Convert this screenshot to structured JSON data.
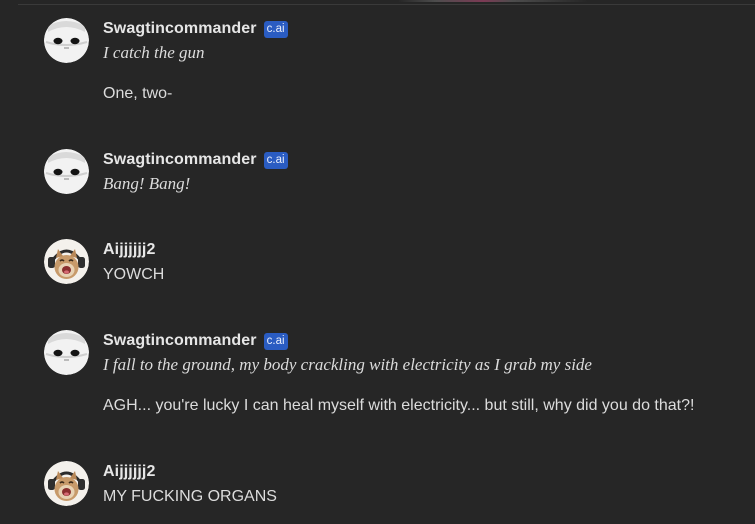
{
  "messages": [
    {
      "author": "Swagtincommander",
      "badge": "c.ai",
      "avatar": "robot-avatar-icon",
      "lines": [
        {
          "text": "I catch the gun",
          "italic": true
        },
        {
          "text": "One, two-",
          "italic": false
        }
      ]
    },
    {
      "author": "Swagtincommander",
      "badge": "c.ai",
      "avatar": "robot-avatar-icon",
      "lines": [
        {
          "text": "Bang! Bang!",
          "italic": true
        }
      ]
    },
    {
      "author": "Aijjjjjj2",
      "badge": null,
      "avatar": "cat-headphones-avatar-icon",
      "lines": [
        {
          "text": "YOWCH",
          "italic": false
        }
      ]
    },
    {
      "author": "Swagtincommander",
      "badge": "c.ai",
      "avatar": "robot-avatar-icon",
      "lines": [
        {
          "text": "I fall to the ground, my body crackling with electricity as I grab my side",
          "italic": true
        },
        {
          "text": "AGH... you're lucky I can heal myself with electricity... but still, why did you do that?!",
          "italic": false
        }
      ]
    },
    {
      "author": "Aijjjjjj2",
      "badge": null,
      "avatar": "cat-headphones-avatar-icon",
      "lines": [
        {
          "text": "MY FUCKING ORGANS",
          "italic": false
        }
      ]
    }
  ],
  "colors": {
    "background": "#262626",
    "badge": "#2a5cc2",
    "text": "#dcdcdc"
  }
}
